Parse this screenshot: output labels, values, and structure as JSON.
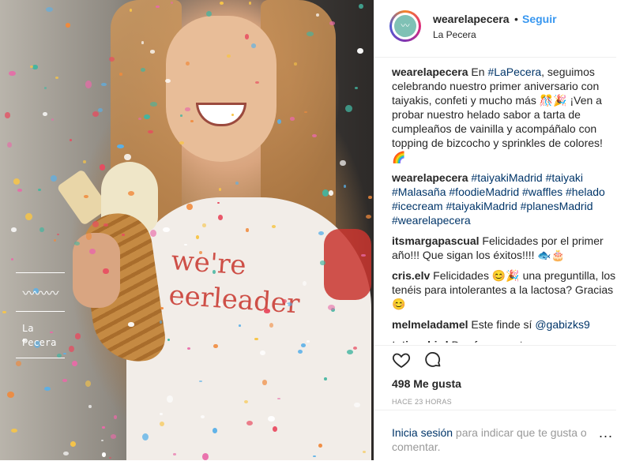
{
  "photo": {
    "logo_text_line1": "La",
    "logo_text_line2": "Pecera",
    "shirt_text": "we're eerleader"
  },
  "header": {
    "username": "wearelapecera",
    "separator": "•",
    "follow_label": "Seguir",
    "location": "La Pecera"
  },
  "caption": {
    "user": "wearelapecera",
    "parts": [
      {
        "t": " En "
      },
      {
        "tag": "#LaPecera"
      },
      {
        "t": ", seguimos celebrando nuestro primer aniversario con taiyakis, confeti y mucho más 🎊🎉 ¡Ven a probar nuestro helado sabor a tarta de cumpleaños de vainilla y acompáñalo con topping de bizcocho y sprinkles de colores! 🌈"
      }
    ]
  },
  "hashtags": {
    "user": "wearelapecera",
    "tags": [
      "#taiyakiMadrid",
      "#taiyaki",
      "#Malasaña",
      "#foodieMadrid",
      "#waffles",
      "#helado",
      "#icecream",
      "#taiyakiMadrid",
      "#planesMadrid",
      "#wearelapecera"
    ]
  },
  "comments": [
    {
      "user": "itsmargapascual",
      "parts": [
        {
          "t": " Felicidades por el primer año!!! Que sigan los éxitos!!!! 🐟🎂"
        }
      ]
    },
    {
      "user": "cris.elv",
      "parts": [
        {
          "t": " Felicidades 😊🎉 una preguntilla, los tenéis para intolerantes a la lactosa? Gracias 😊"
        }
      ]
    },
    {
      "user": "melmeladamel",
      "parts": [
        {
          "t": " Este finde sí "
        },
        {
          "tag": "@gabizks9"
        }
      ]
    },
    {
      "user": "tatina_bird",
      "parts": [
        {
          "t": " Doy fe que esta muy muy"
        }
      ]
    }
  ],
  "actions": {
    "heart_icon": "heart-icon",
    "comment_icon": "comment-icon",
    "likes": "498 Me gusta",
    "time": "HACE 23 HORAS"
  },
  "footer": {
    "login_link": "Inicia sesión",
    "login_text": " para indicar que te gusta o comentar.",
    "more": "..."
  },
  "colors": {
    "link": "#3897f0",
    "tag": "#003569",
    "muted": "#999999"
  }
}
